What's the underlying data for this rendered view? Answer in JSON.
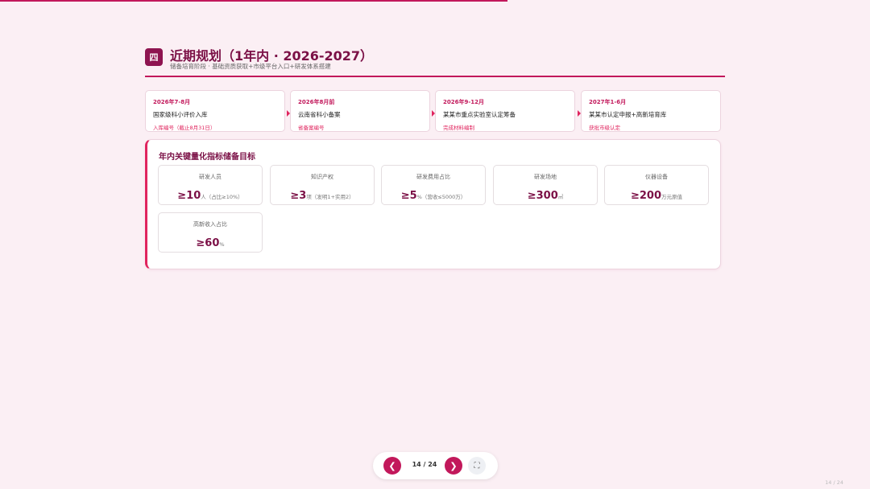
{
  "progress": {
    "value": 0.583,
    "color": "#c2185b"
  },
  "header": {
    "badge": "四",
    "title": "近期规划（1年内 · 2026-2027）",
    "subtitle": "储备培育阶段 · 基础资质获取+市级平台入口+研发体系搭建"
  },
  "timeline": [
    {
      "date": "2026年7-8月",
      "title": "国家级科小评价入库",
      "note": "入库编号（截止8月31日）"
    },
    {
      "date": "2026年8月前",
      "title": "云南省科小备案",
      "note": "省备案编号"
    },
    {
      "date": "2026年9-12月",
      "title": "某某市重点实验室认定筹备",
      "note": "完成材料编制"
    },
    {
      "date": "2027年1-6月",
      "title": "某某市认定申报+高新培育库",
      "note": "获批市级认定"
    }
  ],
  "kpi": {
    "title": "年内关键量化指标储备目标",
    "items": [
      {
        "label": "研发人员",
        "value": "≥10",
        "unit": "人（占比≥10%）"
      },
      {
        "label": "知识产权",
        "value": "≥3",
        "unit": "项（发明1+实用2）"
      },
      {
        "label": "研发费用占比",
        "value": "≥5",
        "unit": "%（营收≤5000万）"
      },
      {
        "label": "研发场地",
        "value": "≥300",
        "unit": "㎡"
      },
      {
        "label": "仪器设备",
        "value": "≥200",
        "unit": "万元原值"
      },
      {
        "label": "高新收入占比",
        "value": "≥60",
        "unit": "%"
      }
    ]
  },
  "pager": {
    "prev_icon": "❮",
    "page": "14 / 24",
    "next_icon": "❯",
    "fullscreen_icon": "⛶"
  },
  "corner_page": "14 / 24"
}
